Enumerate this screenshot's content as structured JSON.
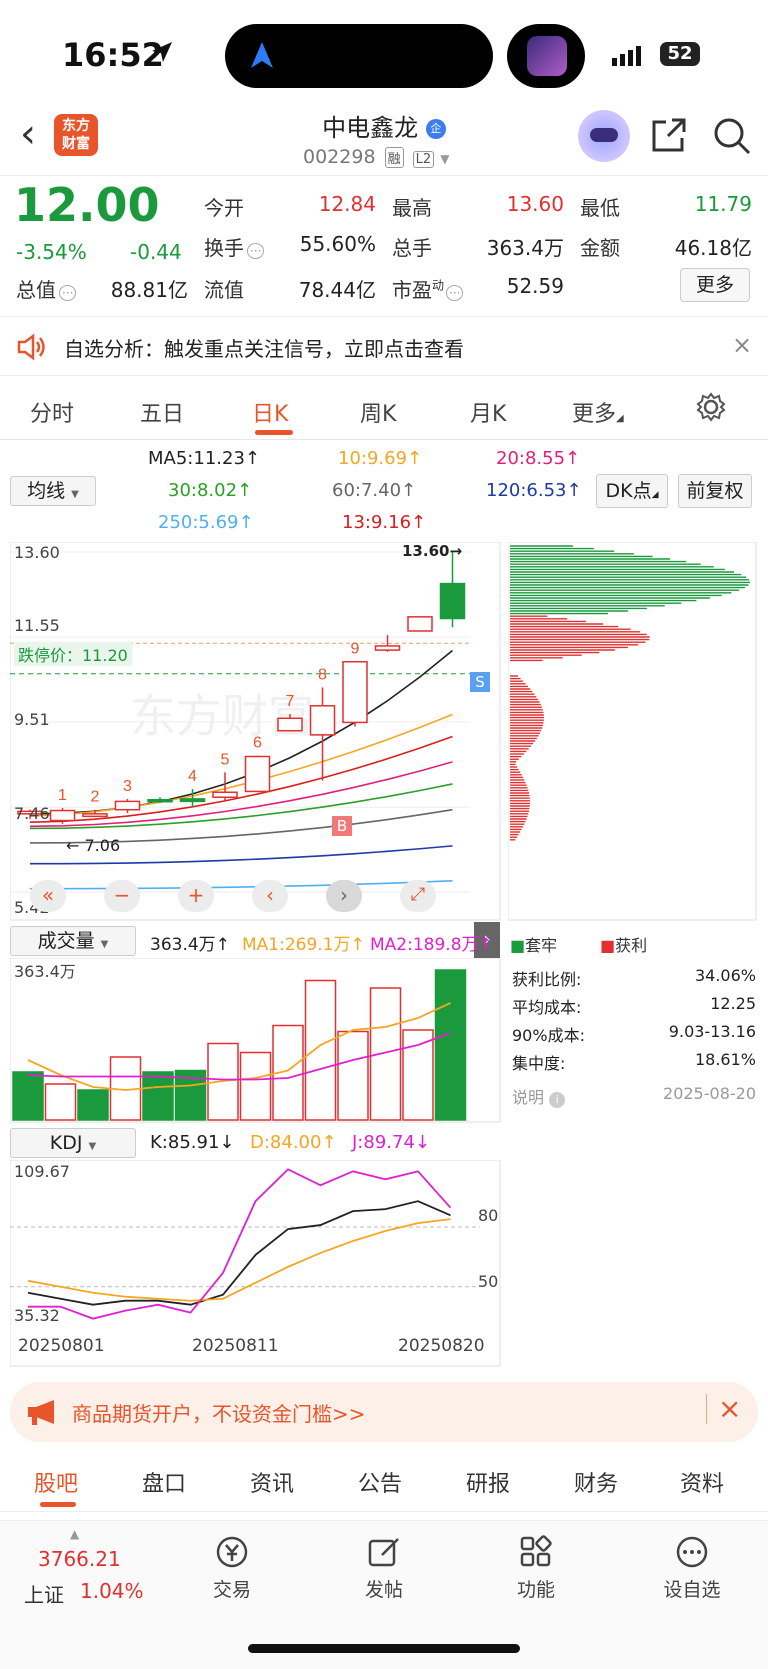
{
  "status_bar": {
    "time": "16:52",
    "battery": "52"
  },
  "header": {
    "back_label": "‹",
    "logo_text": "东方\n财富",
    "stock_name": "中电鑫龙",
    "name_badge": "企",
    "stock_code": "002298",
    "tags": [
      "融",
      "L2"
    ]
  },
  "quote": {
    "price": "12.00",
    "change_pct": "-3.54%",
    "change": "-0.44",
    "fields": [
      {
        "label": "今开",
        "value": "12.84",
        "color": "#e03030"
      },
      {
        "label": "最高",
        "value": "13.60",
        "color": "#e03030"
      },
      {
        "label": "最低",
        "value": "11.79",
        "color": "#1a9a3c"
      },
      {
        "label": "换手",
        "value": "55.60%",
        "color": "#222"
      },
      {
        "label": "总手",
        "value": "363.4万",
        "color": "#222"
      },
      {
        "label": "金额",
        "value": "46.18亿",
        "color": "#222"
      },
      {
        "label": "总值",
        "value": "88.81亿",
        "color": "#222"
      },
      {
        "label": "流值",
        "value": "78.44亿",
        "color": "#222"
      },
      {
        "label": "市盈",
        "value": "52.59",
        "color": "#222"
      }
    ],
    "pe_sup": "动",
    "more_button": "更多"
  },
  "alert": {
    "text": "自选分析：触发重点关注信号，立即点击查看"
  },
  "tabs": [
    "分时",
    "五日",
    "日K",
    "周K",
    "月K",
    "更多"
  ],
  "active_tab": "日K",
  "ma_legend": {
    "selector": "均线",
    "items": [
      {
        "text": "MA5:11.23↑",
        "color": "#222"
      },
      {
        "text": "10:9.69↑",
        "color": "#f5a623"
      },
      {
        "text": "20:8.55↑",
        "color": "#e0207a"
      },
      {
        "text": "30:8.02↑",
        "color": "#2aa02a"
      },
      {
        "text": "60:7.40↑",
        "color": "#666666"
      },
      {
        "text": "120:6.53↑",
        "color": "#1e3aa8"
      },
      {
        "text": "250:5.69↑",
        "color": "#4fb0f0"
      },
      {
        "text": "13:9.16↑",
        "color": "#d81e1e"
      }
    ],
    "dk_button": "DK点",
    "adjust_button": "前复权"
  },
  "kline": {
    "y_labels": [
      "13.60",
      "11.55",
      "9.51",
      "7.46",
      "5.42"
    ],
    "limit_label": "跌停价：11.20",
    "high_mark": "13.60→",
    "low_mark": "7.06",
    "signal_b": "B",
    "signal_s": "S",
    "watermark": "东方财富",
    "candles": [
      {
        "o": 7.3,
        "c": 7.36,
        "h": 7.4,
        "l": 7.18,
        "up": false,
        "color": "#e03030"
      },
      {
        "o": 7.14,
        "c": 7.38,
        "h": 7.44,
        "l": 7.06,
        "up": true,
        "color": "#e03030"
      },
      {
        "o": 7.24,
        "c": 7.3,
        "h": 7.4,
        "l": 7.22,
        "up": true,
        "color": "#e03030"
      },
      {
        "o": 7.4,
        "c": 7.6,
        "h": 7.66,
        "l": 7.32,
        "up": true,
        "color": "#e03030"
      },
      {
        "o": 7.6,
        "c": 7.64,
        "h": 7.7,
        "l": 7.56,
        "up": false,
        "color": "#1a9a3c"
      },
      {
        "o": 7.6,
        "c": 7.66,
        "h": 7.9,
        "l": 7.46,
        "up": false,
        "color": "#1a9a3c"
      },
      {
        "o": 7.7,
        "c": 7.82,
        "h": 8.3,
        "l": 7.62,
        "up": true,
        "color": "#e03030"
      },
      {
        "o": 7.84,
        "c": 8.68,
        "h": 8.7,
        "l": 7.84,
        "up": true,
        "color": "#e03030"
      },
      {
        "o": 9.3,
        "c": 9.6,
        "h": 9.7,
        "l": 9.28,
        "up": true,
        "color": "#e03030"
      },
      {
        "o": 9.2,
        "c": 9.9,
        "h": 10.34,
        "l": 8.1,
        "up": true,
        "color": "#e03030"
      },
      {
        "o": 9.5,
        "c": 10.96,
        "h": 10.96,
        "l": 9.4,
        "up": true,
        "color": "#e03030"
      },
      {
        "o": 11.24,
        "c": 11.34,
        "h": 11.6,
        "l": 11.2,
        "up": true,
        "color": "#e03030"
      },
      {
        "o": 11.7,
        "c": 12.04,
        "h": 12.04,
        "l": 11.7,
        "up": true,
        "color": "#e03030"
      },
      {
        "o": 12.84,
        "c": 12.0,
        "h": 13.6,
        "l": 11.79,
        "up": false,
        "color": "#1a9a3c"
      }
    ],
    "candle_numbers": [
      "",
      "1",
      "2",
      "3",
      "",
      "4",
      "5",
      "6",
      "7",
      "8",
      "9",
      "",
      "",
      ""
    ],
    "chip_legend": {
      "profit_lock": "套牢",
      "profit": "获利"
    },
    "toolbar": [
      "«",
      "−",
      "+",
      "‹",
      "›",
      "⤢"
    ]
  },
  "volume": {
    "selector": "成交量",
    "value": "363.4万↑",
    "ma1": "MA1:269.1万↑",
    "ma2": "MA2:189.8万↑",
    "y_label": "363.4万",
    "bars": [
      0.32,
      0.24,
      0.2,
      0.42,
      0.32,
      0.33,
      0.51,
      0.45,
      0.63,
      0.93,
      0.59,
      0.88,
      0.6,
      1.0
    ],
    "bar_colors": [
      "#1a9a3c",
      "#e03030",
      "#1a9a3c",
      "#e03030",
      "#1a9a3c",
      "#1a9a3c",
      "#e03030",
      "#e03030",
      "#e03030",
      "#e03030",
      "#e03030",
      "#e03030",
      "#e03030",
      "#1a9a3c"
    ]
  },
  "chip_stats": [
    {
      "label": "获利比例:",
      "value": "34.06%"
    },
    {
      "label": "平均成本:",
      "value": "12.25"
    },
    {
      "label": "90%成本:",
      "value": "9.03-13.16"
    },
    {
      "label": "集中度:",
      "value": "18.61%"
    }
  ],
  "chip_note": "说明",
  "chip_date": "2025-08-20",
  "kdj": {
    "selector": "KDJ",
    "k": "K:85.91↓",
    "d": "D:84.00↑",
    "j": "J:89.74↓",
    "y_top": "109.67",
    "y_bottom": "35.32",
    "level_80": "80",
    "level_50": "50",
    "dates": [
      "20250801",
      "20250811",
      "20250820"
    ]
  },
  "ad": {
    "text": "商品期货开户，不设资金门槛>>"
  },
  "bottom_tabs": [
    "股吧",
    "盘口",
    "资讯",
    "公告",
    "研报",
    "财务",
    "资料"
  ],
  "dock": {
    "index_value": "3766.21",
    "index_name": "上证",
    "index_change": "1.04%",
    "items": [
      "交易",
      "发帖",
      "功能",
      "设自选"
    ]
  },
  "colors": {
    "up": "#e03030",
    "down": "#1a9a3c",
    "accent": "#e8552a"
  }
}
